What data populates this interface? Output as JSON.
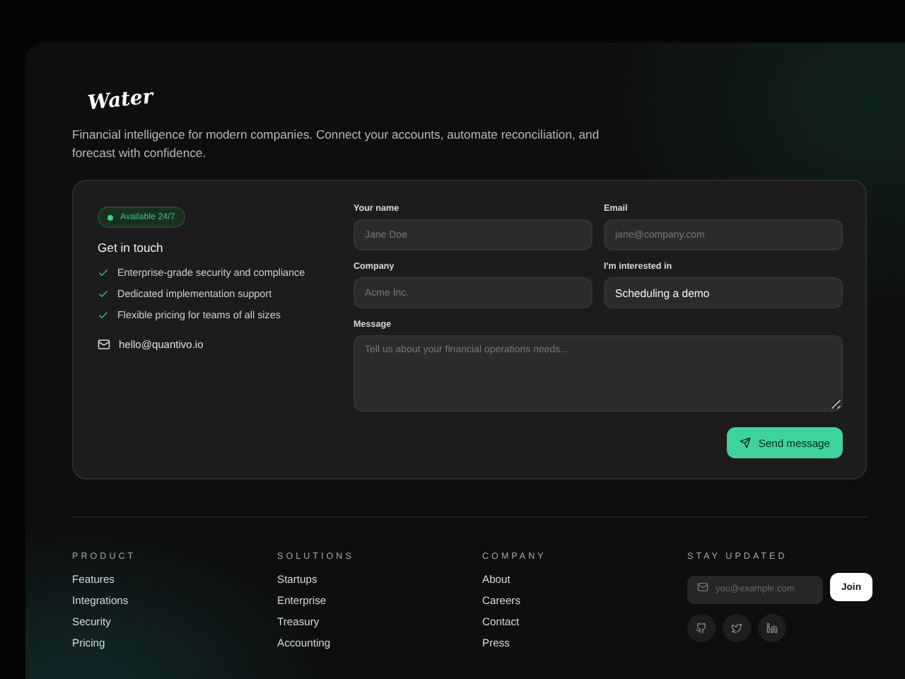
{
  "logo": "Water",
  "tagline": "Financial intelligence for modern companies. Connect your accounts, automate reconciliation, and forecast with confidence.",
  "contact": {
    "badge": "Available 24/7",
    "title": "Get in touch",
    "features": [
      "Enterprise-grade security and compliance",
      "Dedicated implementation support",
      "Flexible pricing for teams of all sizes"
    ],
    "email": "hello@quantivo.io"
  },
  "form": {
    "fields": [
      {
        "label": "Your name",
        "kind": "input",
        "placeholder": "Jane Doe"
      },
      {
        "label": "Email",
        "kind": "input",
        "placeholder": "jane@company.com"
      },
      {
        "label": "Company",
        "kind": "input",
        "placeholder": "Acme Inc."
      },
      {
        "label": "I'm interested in",
        "kind": "select",
        "value": "Scheduling a demo"
      },
      {
        "label": "Message",
        "kind": "textarea",
        "placeholder": "Tell us about your financial operations needs..."
      }
    ],
    "submit": "Send message"
  },
  "footer": {
    "columns": [
      {
        "heading": "PRODUCT",
        "links": [
          "Features",
          "Integrations",
          "Security",
          "Pricing"
        ]
      },
      {
        "heading": "SOLUTIONS",
        "links": [
          "Startups",
          "Enterprise",
          "Treasury",
          "Accounting"
        ]
      },
      {
        "heading": "COMPANY",
        "links": [
          "About",
          "Careers",
          "Contact",
          "Press"
        ]
      }
    ],
    "newsletter": {
      "heading": "STAY UPDATED",
      "placeholder": "you@example.com",
      "button": "Join"
    }
  }
}
